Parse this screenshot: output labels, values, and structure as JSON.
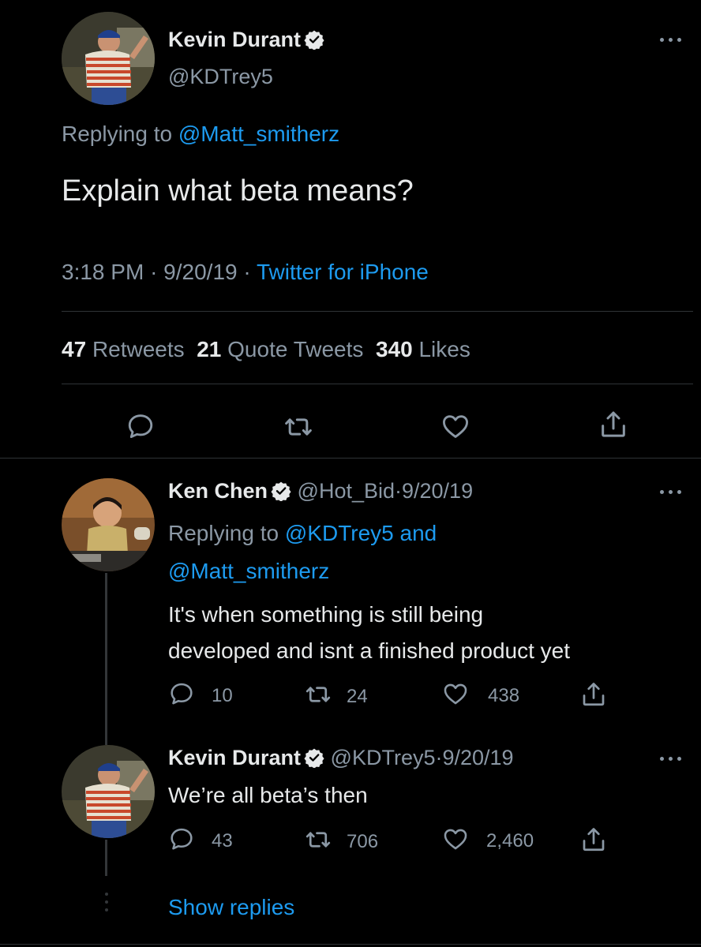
{
  "main_tweet": {
    "display_name": "Kevin Durant",
    "handle": "@KDTrey5",
    "replying_prefix": "Replying to",
    "replying_to": "@Matt_smitherz",
    "text": "Explain what beta means?",
    "time": "3:18 PM",
    "date": "9/20/19",
    "source": "Twitter for iPhone",
    "sep": "·",
    "stats": {
      "retweets_count": "47",
      "retweets_label": "Retweets",
      "quotes_count": "21",
      "quotes_label": "Quote Tweets",
      "likes_count": "340",
      "likes_label": "Likes"
    }
  },
  "reply1": {
    "display_name": "Ken Chen",
    "handle": "@Hot_Bid",
    "date": "9/20/19",
    "replying_prefix": "Replying to",
    "replying_to_1": "@KDTrey5",
    "replying_and": "and",
    "replying_to_2": "@Matt_smitherz",
    "text_line1": "It's when something is still being",
    "text_line2": "developed and isnt a finished product yet",
    "reply_count": "10",
    "retweet_count": "24",
    "like_count": "438"
  },
  "reply2": {
    "display_name": "Kevin Durant",
    "handle": "@KDTrey5",
    "date": "9/20/19",
    "text": "We’re all beta’s then",
    "reply_count": "43",
    "retweet_count": "706",
    "like_count": "2,460"
  },
  "show_replies": "Show replies",
  "icons": {
    "reply": "reply-icon",
    "retweet": "retweet-icon",
    "like": "heart-icon",
    "share": "share-icon",
    "verified": "verified-badge-icon",
    "more": "more-icon"
  },
  "colors": {
    "background": "#000000",
    "text": "#e7e9ea",
    "secondary": "#8b98a5",
    "link": "#1d9bf0",
    "divider": "#2f3336"
  }
}
